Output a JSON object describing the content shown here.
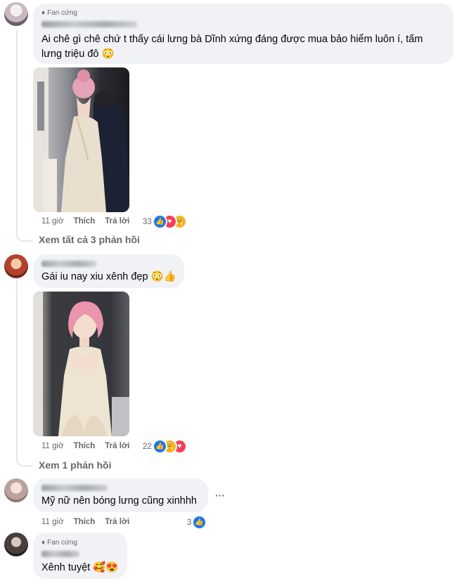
{
  "comments": [
    {
      "badge": "Fan cứng",
      "text_line1": "Ai chê gì chê chứ t thấy cái lưng bà Dĩnh xứng đáng được mua bảo hiểm luôn í, tấm",
      "text_line2": "lưng triệu đô",
      "emoji": "😳",
      "time": "11 giờ",
      "like": "Thích",
      "reply": "Trả lời",
      "reactions": "33",
      "reaction_icons": [
        "like-icon",
        "love-icon",
        "care-icon"
      ],
      "view_replies": "Xem tất cả 3 phản hồi"
    },
    {
      "text": "Gái iu nay xiu xênh đẹp",
      "emojis": "😳👍",
      "time": "11 giờ",
      "like": "Thích",
      "reply": "Trả lời",
      "reactions": "22",
      "reaction_icons": [
        "like-icon",
        "care-icon",
        "love-icon"
      ],
      "view_replies": "Xem 1 phản hồi"
    },
    {
      "text": "Mỹ nữ nên bóng lưng cũng xinhhh",
      "more": "···",
      "time": "11 giờ",
      "like": "Thích",
      "reply": "Trả lời",
      "reactions": "3",
      "reaction_icons": [
        "like-icon"
      ]
    },
    {
      "badge": "Fan cứng",
      "text": "Xênh tuyệt",
      "emojis": "🥰😍"
    }
  ],
  "colors": {
    "bubble": "#f0f2f5",
    "secondary_text": "#65676b",
    "like_blue": "#1877f2",
    "love_red": "#f33e58",
    "care_yellow": "#f7b125"
  }
}
